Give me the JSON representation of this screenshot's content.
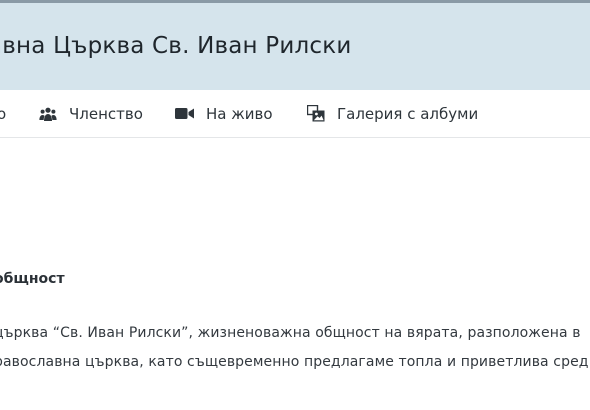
{
  "header": {
    "title": "авна Църква Св. Иван Рилски"
  },
  "nav": {
    "items": [
      {
        "label": "о",
        "icon": "none"
      },
      {
        "label": "Членство",
        "icon": "users-icon"
      },
      {
        "label": "На живо",
        "icon": "video-camera-icon"
      },
      {
        "label": "Галерия с албуми",
        "icon": "photo-gallery-icon"
      }
    ]
  },
  "content": {
    "section_title": "общност",
    "paragraph_line_1": "църква “Св. Иван Рилски”, жизненоважна общност на вярата, разположена в",
    "paragraph_line_2": "равославна църква, като същевременно предлагаме топла и приветлива сред"
  },
  "colors": {
    "banner": "#d5e4ec",
    "text": "#333a40"
  }
}
